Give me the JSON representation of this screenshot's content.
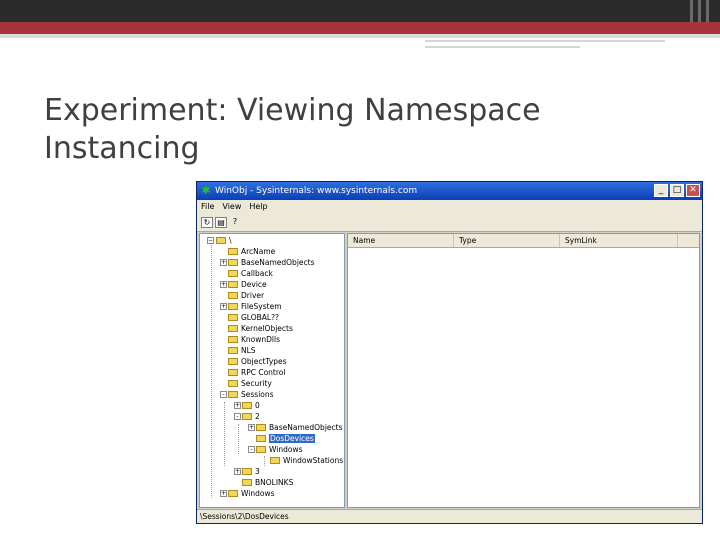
{
  "slide": {
    "title": "Experiment: Viewing Namespace Instancing"
  },
  "window": {
    "title": "WinObj - Sysinternals: www.sysinternals.com",
    "controls": {
      "minimize": "_",
      "maximize": "□",
      "close": "✕"
    },
    "menu": [
      "File",
      "View",
      "Help"
    ],
    "list_columns": [
      "Name",
      "Type",
      "SymLink"
    ],
    "status": "\\Sessions\\2\\DosDevices"
  },
  "tree": {
    "root": "\\",
    "items": [
      {
        "label": "ArcName",
        "expander": ""
      },
      {
        "label": "BaseNamedObjects",
        "expander": "+"
      },
      {
        "label": "Callback",
        "expander": ""
      },
      {
        "label": "Device",
        "expander": "+"
      },
      {
        "label": "Driver",
        "expander": ""
      },
      {
        "label": "FileSystem",
        "expander": "+"
      },
      {
        "label": "GLOBAL??",
        "expander": ""
      },
      {
        "label": "KernelObjects",
        "expander": ""
      },
      {
        "label": "KnownDlls",
        "expander": ""
      },
      {
        "label": "NLS",
        "expander": ""
      },
      {
        "label": "ObjectTypes",
        "expander": ""
      },
      {
        "label": "RPC Control",
        "expander": ""
      },
      {
        "label": "Security",
        "expander": ""
      },
      {
        "label": "Sessions",
        "expander": "-"
      },
      {
        "label": "0",
        "expander": "+"
      },
      {
        "label": "2",
        "expander": "-"
      },
      {
        "label": "BaseNamedObjects",
        "expander": "+"
      },
      {
        "label": "DosDevices",
        "expander": ""
      },
      {
        "label": "Windows",
        "expander": "-"
      },
      {
        "label": "WindowStations",
        "expander": ""
      },
      {
        "label": "3",
        "expander": "+"
      },
      {
        "label": "BNOLINKS",
        "expander": ""
      },
      {
        "label": "Windows",
        "expander": "+"
      }
    ]
  }
}
